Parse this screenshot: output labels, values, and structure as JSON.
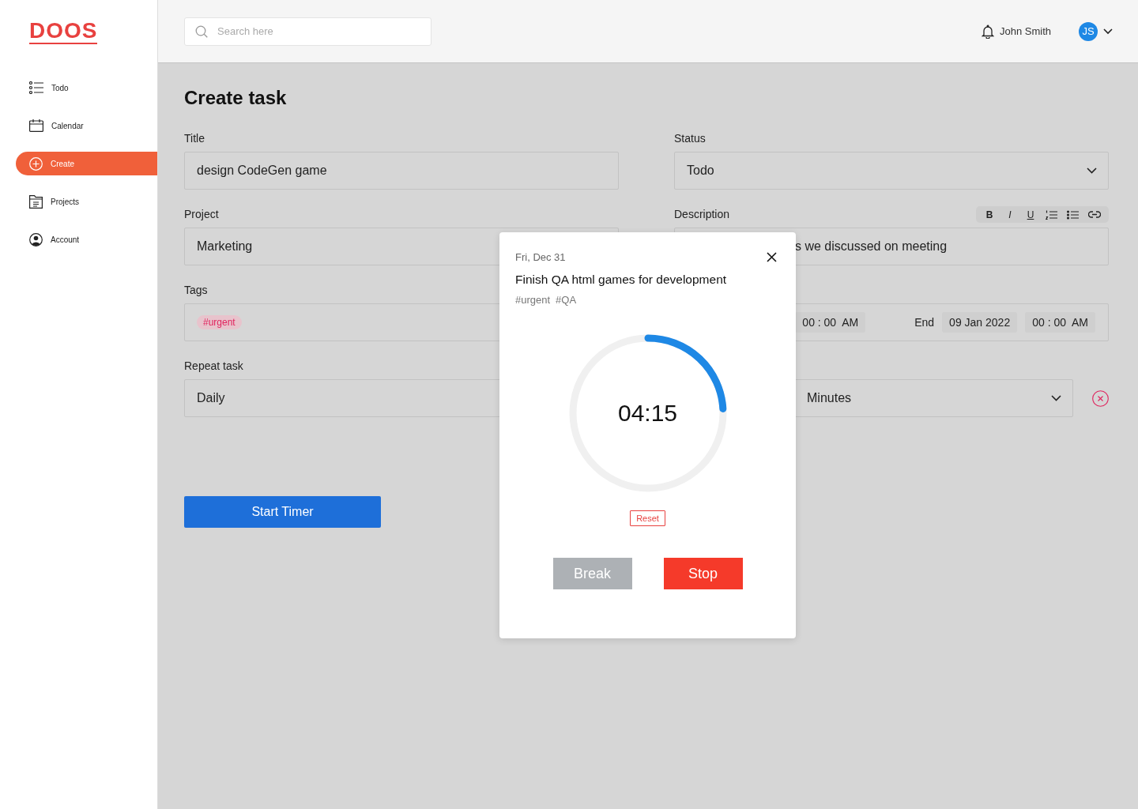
{
  "sidebar": {
    "logo": "DOOS",
    "items": [
      {
        "label": "Todo",
        "selected": false
      },
      {
        "label": "Calendar",
        "selected": false
      },
      {
        "label": "Create",
        "selected": true
      },
      {
        "label": "Projects",
        "selected": false
      },
      {
        "label": "Account",
        "selected": false
      }
    ]
  },
  "header": {
    "search": {
      "placeholder": "Search here"
    },
    "user_name": "John Smith",
    "avatar_initials": "JS"
  },
  "form": {
    "heading": "Create task",
    "title": {
      "label": "Title",
      "value": "design CodeGen game"
    },
    "status": {
      "label": "Status",
      "value": "Todo"
    },
    "project": {
      "label": "Project",
      "value": "Marketing"
    },
    "description": {
      "label": "Description",
      "value": "s we discussed on meeting",
      "format_buttons": [
        "B",
        "I",
        "U"
      ]
    },
    "tags": {
      "label": "Tags",
      "items": [
        "#urgent"
      ]
    },
    "schedule": {
      "start_time": "00 : 00  AM",
      "end_label": "End",
      "end_date": "09 Jan 2022",
      "end_time": "00 : 00  AM"
    },
    "repeat": {
      "label": "Repeat task",
      "value": "Daily",
      "unit": "Minutes"
    },
    "start_button": "Start Timer"
  },
  "timer_dialog": {
    "date": "Fri, Dec 31",
    "title": "Finish QA html games for development",
    "tags": [
      "#urgent",
      "#QA"
    ],
    "time": "04:15",
    "level": 0.24,
    "reset_button": "Reset",
    "break_button": "Break",
    "stop_button": "Stop"
  }
}
